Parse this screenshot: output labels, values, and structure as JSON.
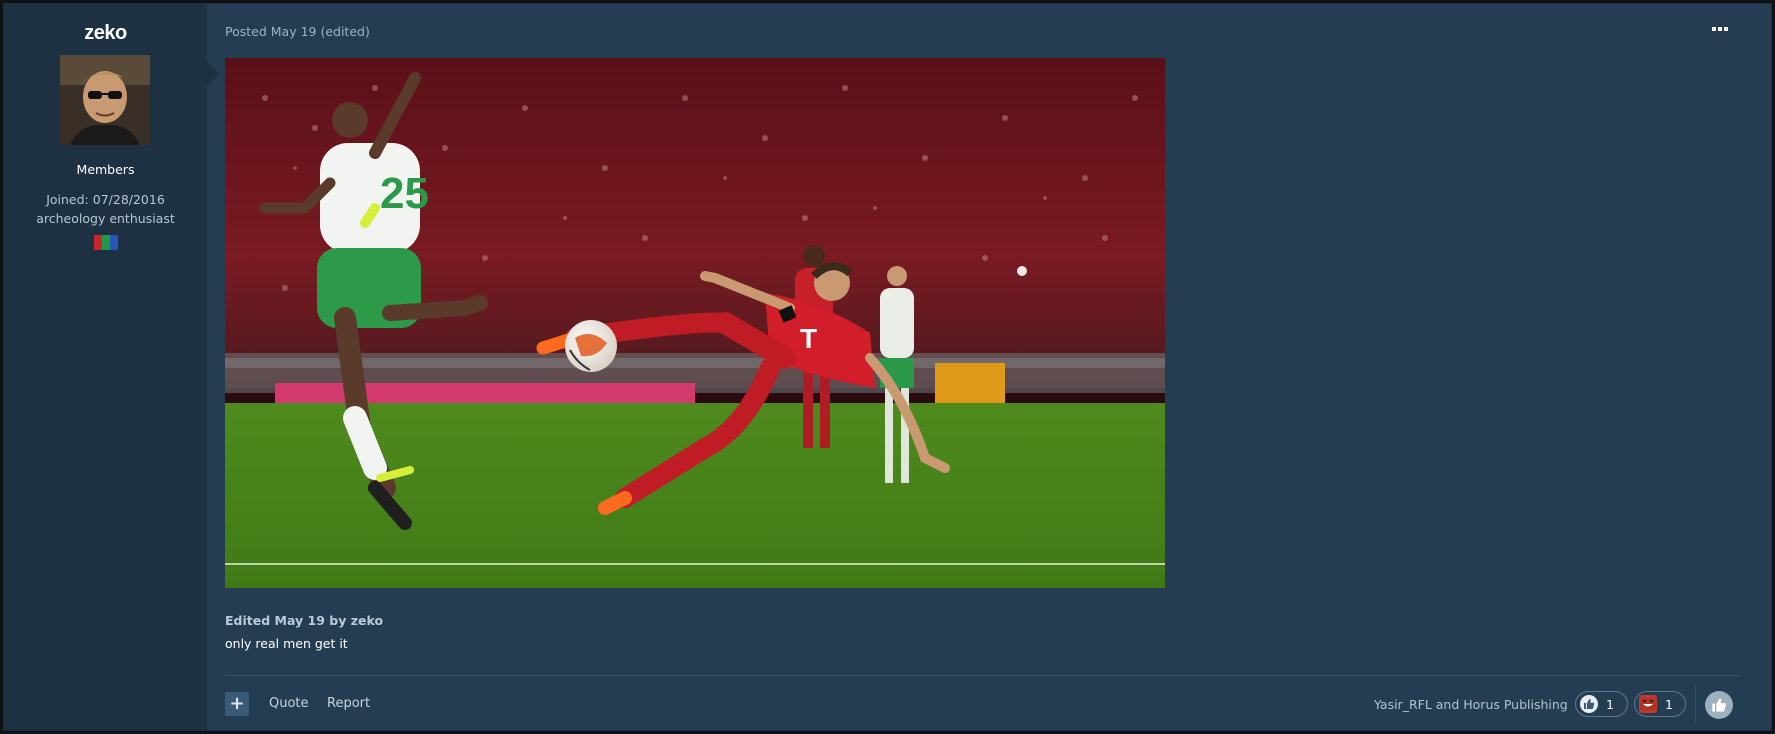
{
  "author": {
    "name": "zeko",
    "group": "Members",
    "joined": "Joined: 07/28/2016",
    "title": "archeology enthusiast",
    "flag_colors": [
      "#c9262c",
      "#1f9a4a",
      "#2556b8"
    ]
  },
  "post": {
    "date_text": "Posted May 19 (edited)",
    "menu_icon": "ellipsis-icon",
    "edited_text": "Edited May 19 by zeko",
    "body": "only real men get it",
    "image_icon": "football-photo"
  },
  "actions": {
    "multiquote_symbol": "+",
    "quote_label": "Quote",
    "report_label": "Report"
  },
  "reactions": {
    "reactors_text": "Yasir_RFL and Horus Publishing",
    "items": [
      {
        "icon": "thumbs-up-icon",
        "count": "1",
        "color": "#e8edf1"
      },
      {
        "icon": "haha-icon",
        "count": "1",
        "color": "#c0392b"
      }
    ],
    "react_button_icon": "thumbs-up-icon"
  }
}
